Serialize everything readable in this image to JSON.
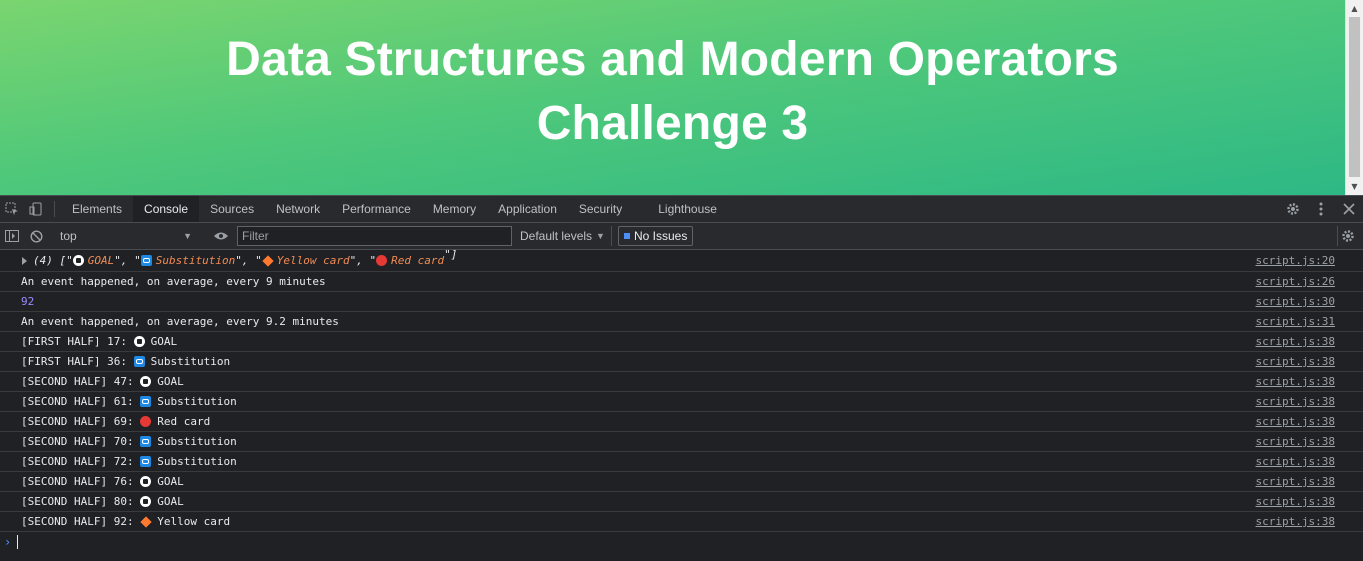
{
  "page": {
    "title_line1": "Data Structures and Modern Operators",
    "title_line2": "Challenge 3"
  },
  "devtools": {
    "tabs": [
      "Elements",
      "Console",
      "Sources",
      "Network",
      "Performance",
      "Memory",
      "Application",
      "Security",
      "Lighthouse"
    ],
    "active_tab": "Console",
    "toolbar": {
      "context": "top",
      "filter_placeholder": "Filter",
      "levels": "Default levels",
      "issues": "No Issues"
    },
    "console": {
      "array_summary": {
        "count": "(4)",
        "items": [
          "GOAL",
          "Substitution",
          "Yellow card",
          "Red card"
        ],
        "icons": [
          "soccer-ball",
          "substitution",
          "yellow-card",
          "red-card"
        ],
        "source": "script.js:20"
      },
      "messages": [
        {
          "text": "An event happened, on average, every 9 minutes",
          "source": "script.js:26"
        },
        {
          "text": "92",
          "source": "script.js:30",
          "kind": "number"
        },
        {
          "text": "An event happened, on average, every 9.2 minutes",
          "source": "script.js:31"
        },
        {
          "prefix": "[FIRST HALF] 17:",
          "icon": "soccer-ball",
          "event": "GOAL",
          "source": "script.js:38"
        },
        {
          "prefix": "[FIRST HALF] 36:",
          "icon": "substitution",
          "event": "Substitution",
          "source": "script.js:38"
        },
        {
          "prefix": "[SECOND HALF] 47:",
          "icon": "soccer-ball",
          "event": "GOAL",
          "source": "script.js:38"
        },
        {
          "prefix": "[SECOND HALF] 61:",
          "icon": "substitution",
          "event": "Substitution",
          "source": "script.js:38"
        },
        {
          "prefix": "[SECOND HALF] 69:",
          "icon": "red-card",
          "event": "Red card",
          "source": "script.js:38"
        },
        {
          "prefix": "[SECOND HALF] 70:",
          "icon": "substitution",
          "event": "Substitution",
          "source": "script.js:38"
        },
        {
          "prefix": "[SECOND HALF] 72:",
          "icon": "substitution",
          "event": "Substitution",
          "source": "script.js:38"
        },
        {
          "prefix": "[SECOND HALF] 76:",
          "icon": "soccer-ball",
          "event": "GOAL",
          "source": "script.js:38"
        },
        {
          "prefix": "[SECOND HALF] 80:",
          "icon": "soccer-ball",
          "event": "GOAL",
          "source": "script.js:38"
        },
        {
          "prefix": "[SECOND HALF] 92:",
          "icon": "yellow-card",
          "event": "Yellow card",
          "source": "script.js:38"
        }
      ]
    }
  },
  "colors": {
    "gradient_start": "#7ad56f",
    "gradient_end": "#2db885",
    "devtools_bg": "#202124",
    "string_color": "#f28b54",
    "number_color": "#9e8aff"
  }
}
